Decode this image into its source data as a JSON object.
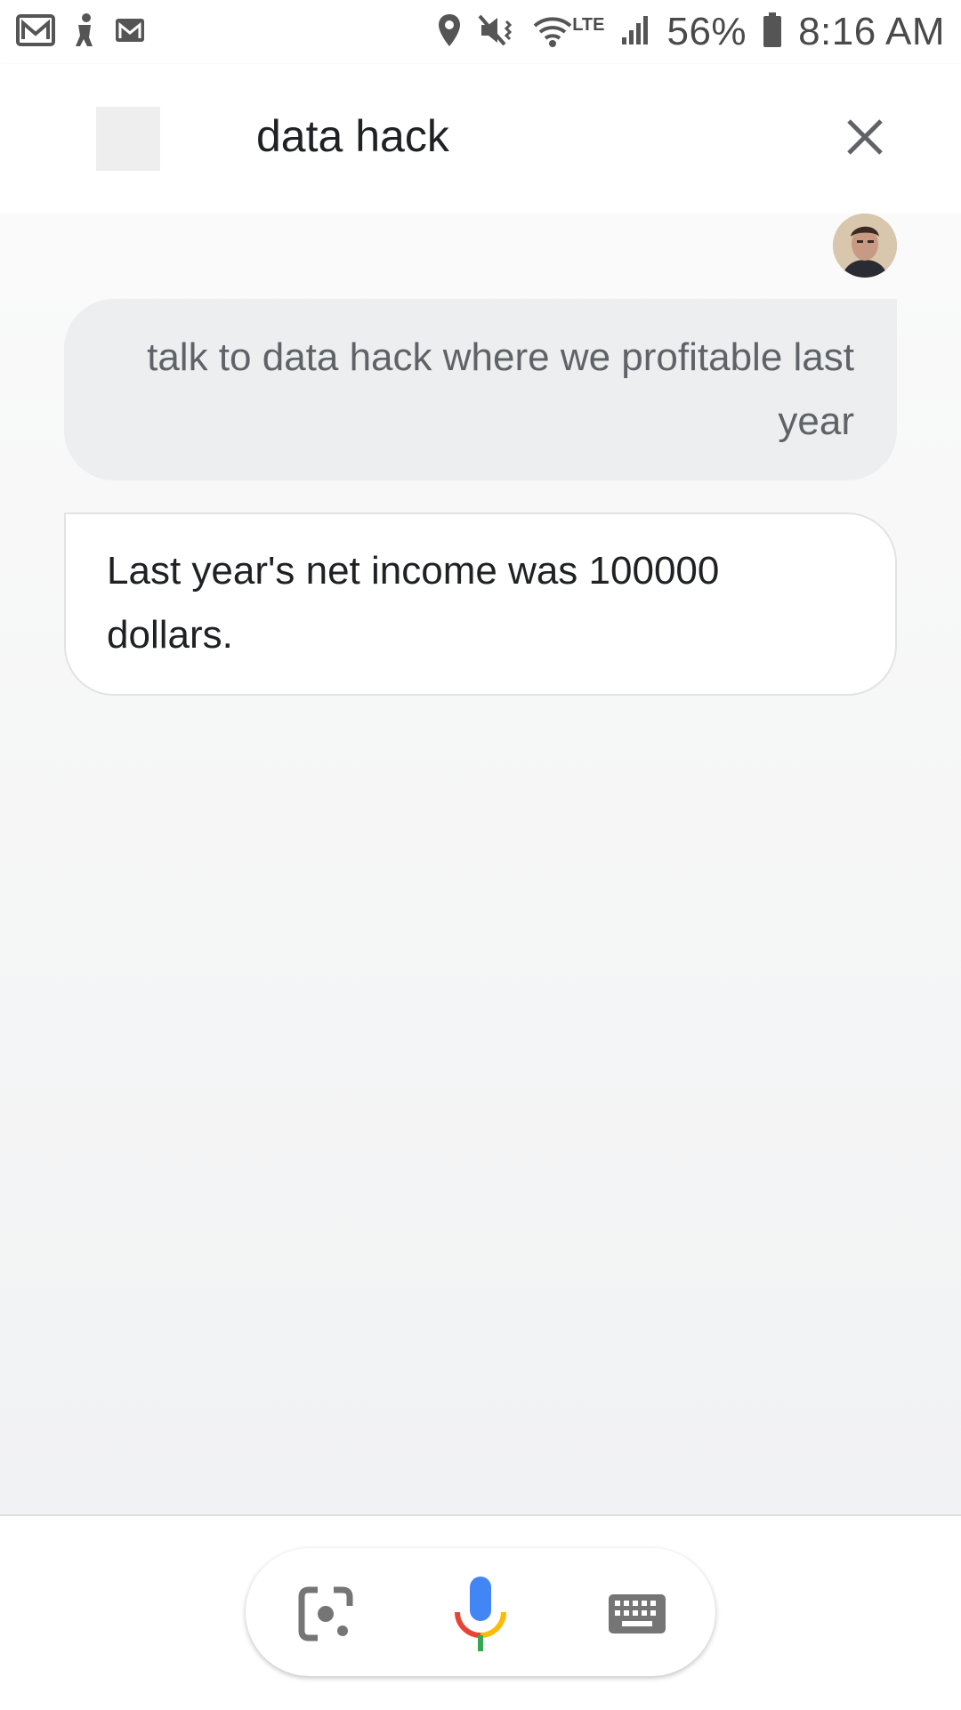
{
  "status_bar": {
    "left_icons": [
      "gmail-icon",
      "figure-icon",
      "gmail-icon"
    ],
    "right_icons": [
      "location-icon",
      "vibrate-mute-icon",
      "wifi-icon",
      "signal-icon",
      "battery-icon"
    ],
    "network_label": "LTE",
    "battery": "56%",
    "time": "8:16 AM"
  },
  "app_bar": {
    "title": "data hack",
    "close_icon": "close-icon"
  },
  "conversation": {
    "user_message": "talk to data hack where we profitable last year",
    "assistant_reply": "Last year's net income was 100000 dollars."
  },
  "bottom_bar": {
    "buttons": [
      "lens-icon",
      "mic-icon",
      "keyboard-icon"
    ]
  },
  "colors": {
    "mic_blue": "#4285F4",
    "mic_red": "#EA4335",
    "mic_yellow": "#FBBC05",
    "mic_green": "#34A853"
  }
}
